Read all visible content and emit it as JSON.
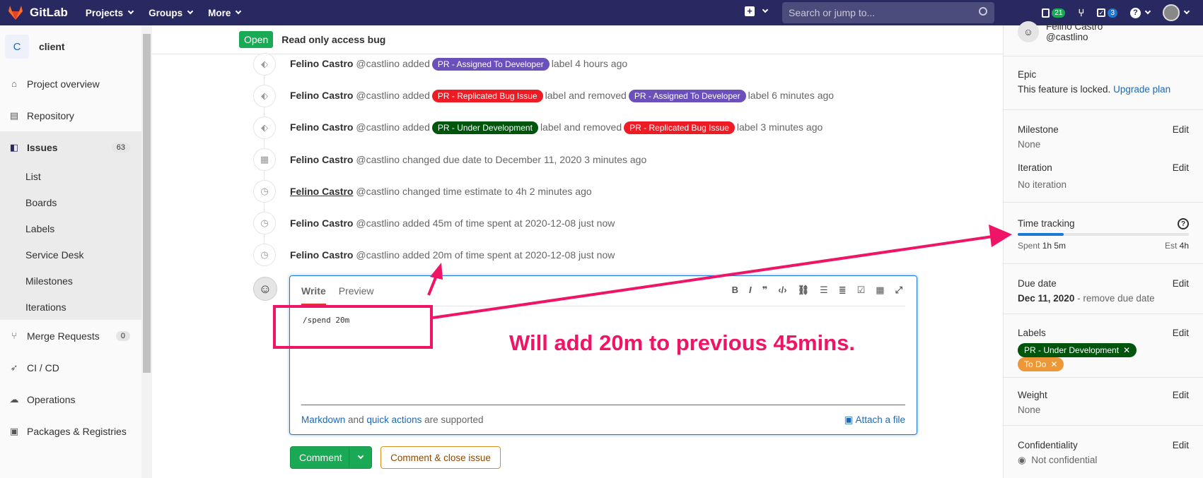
{
  "topbar": {
    "brand": "GitLab",
    "nav": [
      "Projects",
      "Groups",
      "More"
    ],
    "search_placeholder": "Search or jump to...",
    "mr_count": "21",
    "todo_count": "3"
  },
  "sidebar": {
    "project_initial": "C",
    "project_name": "client",
    "items": [
      {
        "label": "Project overview",
        "icon": "home-icon"
      },
      {
        "label": "Repository",
        "icon": "doc-icon"
      },
      {
        "label": "Issues",
        "icon": "issues-icon",
        "count": "63"
      },
      {
        "label": "Merge Requests",
        "icon": "merge-icon",
        "count": "0"
      },
      {
        "label": "CI / CD",
        "icon": "rocket-icon"
      },
      {
        "label": "Operations",
        "icon": "cloud-icon"
      },
      {
        "label": "Packages & Registries",
        "icon": "package-icon"
      }
    ],
    "issues_sub": [
      "List",
      "Boards",
      "Labels",
      "Service Desk",
      "Milestones",
      "Iterations"
    ]
  },
  "issue": {
    "status": "Open",
    "title": "Read only access bug"
  },
  "notes": [
    {
      "author": "Felino Castro",
      "handle": "@castlino",
      "pre": "added",
      "label1": "PR - Assigned To Developer",
      "mid": "label 4 hours ago"
    },
    {
      "author": "Felino Castro",
      "handle": "@castlino",
      "pre": "added",
      "label1": "PR - Replicated Bug Issue",
      "mid": "label and removed",
      "label2": "PR - Assigned To Developer",
      "post": "label 6 minutes ago"
    },
    {
      "author": "Felino Castro",
      "handle": "@castlino",
      "pre": "added",
      "label1": "PR - Under Development",
      "mid": "label and removed",
      "label2": "PR - Replicated Bug Issue",
      "post": "label 3 minutes ago"
    },
    {
      "author": "Felino Castro",
      "handle": "@castlino",
      "text": "changed due date to December 11, 2020 3 minutes ago"
    },
    {
      "author": "Felino Castro",
      "handle": "@castlino",
      "text": "changed time estimate to 4h 2 minutes ago"
    },
    {
      "author": "Felino Castro",
      "handle": "@castlino",
      "text": "added 45m of time spent at 2020-12-08 just now"
    },
    {
      "author": "Felino Castro",
      "handle": "@castlino",
      "text": "added 20m of time spent at 2020-12-08 just now"
    }
  ],
  "editor": {
    "tab_write": "Write",
    "tab_preview": "Preview",
    "content": "/spend 20m",
    "md_link": "Markdown",
    "md_and": "and",
    "qa_link": "quick actions",
    "md_supported": "are supported",
    "attach": "Attach a file",
    "comment_btn": "Comment",
    "close_btn": "Comment & close issue"
  },
  "annotation": {
    "text": "Will add 20m to previous 45mins."
  },
  "right_panel": {
    "assignee_name": "Felino Castro",
    "assignee_handle": "@castlino",
    "epic_title": "Epic",
    "epic_locked": "This feature is locked.",
    "epic_upgrade": "Upgrade plan",
    "milestone_title": "Milestone",
    "milestone_value": "None",
    "iteration_title": "Iteration",
    "iteration_value": "No iteration",
    "edit": "Edit",
    "time_title": "Time tracking",
    "spent_label": "Spent",
    "spent_value": "1h 5m",
    "est_label": "Est",
    "est_value": "4h",
    "spent_fraction": 0.27,
    "due_title": "Due date",
    "due_value": "Dec 11, 2020",
    "due_remove": "- remove due date",
    "labels_title": "Labels",
    "label_a": "PR - Under Development",
    "label_b": "To Do",
    "weight_title": "Weight",
    "weight_value": "None",
    "conf_title": "Confidentiality",
    "conf_value": "Not confidential"
  },
  "colors": {
    "topbar": "#292961",
    "annotation": "#f01466",
    "green": "#1aaa55",
    "purple_label": "#6b4fbb",
    "red_label": "#ed1c24",
    "darkgreen_label": "#00550d",
    "orange_label": "#ed9838"
  }
}
